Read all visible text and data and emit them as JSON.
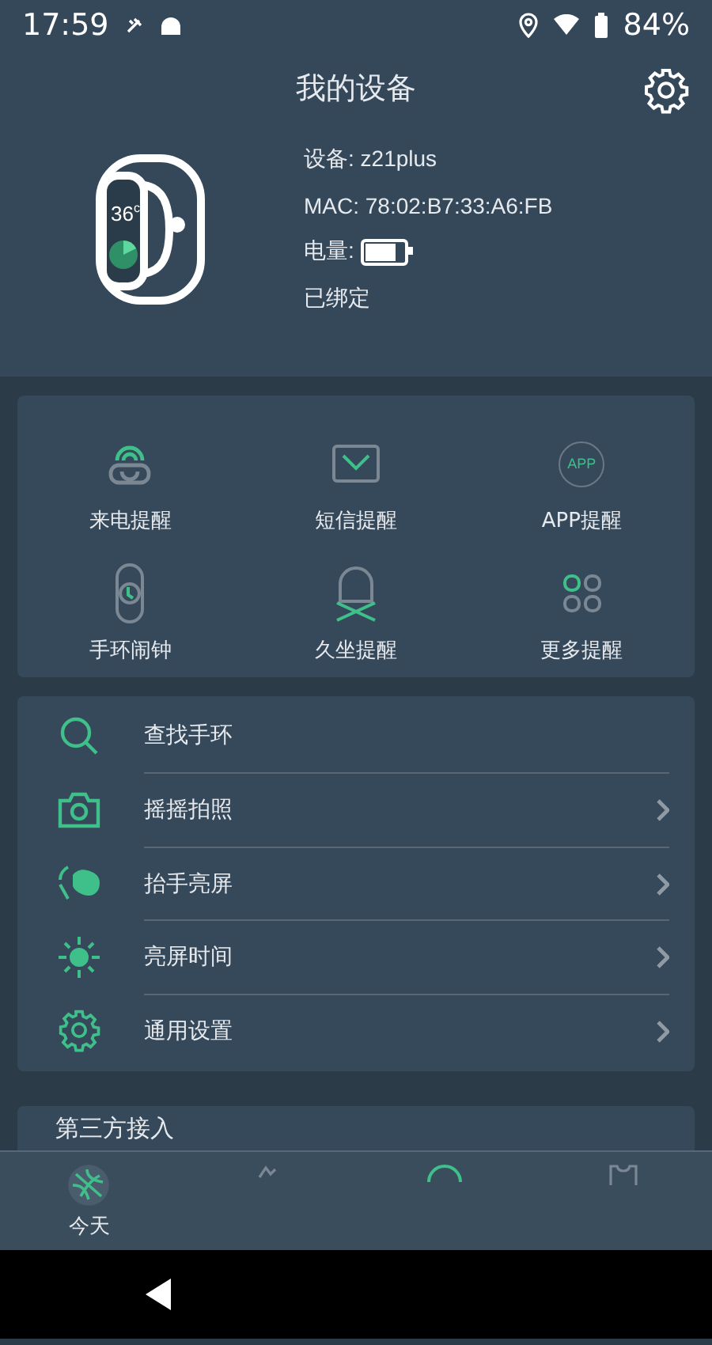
{
  "status_bar": {
    "time": "17:59",
    "battery": "84%"
  },
  "header": {
    "title": "我的设备"
  },
  "device": {
    "name": "设备: z21plus",
    "mac": "MAC: 78:02:B7:33:A6:FB",
    "battery": {
      "label": "电量:",
      "level": 0.8
    },
    "bind_status": "已绑定",
    "temperature": "36",
    "temperature_unit": "c"
  },
  "reminders": [
    {
      "label": "来电提醒"
    },
    {
      "label": "短信提醒"
    },
    {
      "label": "APP提醒",
      "icon_text": "APP"
    },
    {
      "label": "手环闹钟"
    },
    {
      "label": "久坐提醒"
    },
    {
      "label": "更多提醒"
    }
  ],
  "menu": [
    {
      "label": "查找手环",
      "chevron": false
    },
    {
      "label": "摇摇拍照",
      "chevron": true
    },
    {
      "label": "抬手亮屏",
      "chevron": true
    },
    {
      "label": "亮屏时间",
      "chevron": true
    },
    {
      "label": "通用设置",
      "chevron": true
    }
  ],
  "section_title": "第三方接入",
  "bottom_nav": [
    {
      "label": "今天",
      "selected": true
    },
    {
      "selected": false
    },
    {
      "selected": false
    },
    {
      "selected": false
    }
  ]
}
